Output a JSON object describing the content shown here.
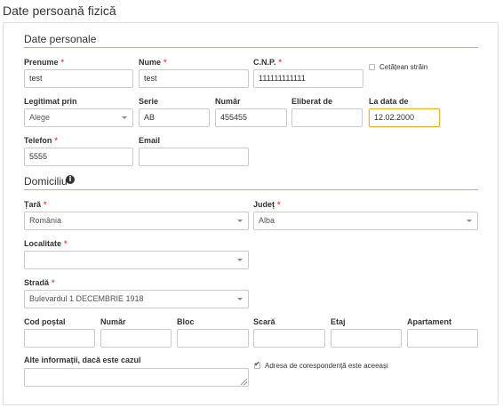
{
  "page": {
    "title": "Date persoană fizică"
  },
  "sections": {
    "personal": "Date personale",
    "domicile": "Domiciliu"
  },
  "colors": {
    "accent": "#f0a92e",
    "required": "#d9534f",
    "focus": "#f0b429"
  },
  "personal": {
    "first_name": {
      "label": "Prenume",
      "value": "test"
    },
    "last_name": {
      "label": "Nume",
      "value": "test"
    },
    "cnp": {
      "label": "C.N.P.",
      "value": "111111111111"
    },
    "foreign_citizen": {
      "label": "Cetățean străin",
      "checked": false
    },
    "id_type": {
      "label": "Legitimat prin",
      "value": "Alege"
    },
    "series": {
      "label": "Serie",
      "value": "AB"
    },
    "number": {
      "label": "Număr",
      "value": "455455"
    },
    "issued_by": {
      "label": "Eliberat de",
      "value": ""
    },
    "issued_date": {
      "label": "La data de",
      "value": "12.02.2000"
    },
    "phone": {
      "label": "Telefon",
      "value": "5555"
    },
    "email": {
      "label": "Email",
      "value": ""
    }
  },
  "domicile": {
    "country": {
      "label": "Țară",
      "value": "România"
    },
    "county": {
      "label": "Județ",
      "value": "Alba"
    },
    "locality": {
      "label": "Localitate",
      "value": ""
    },
    "street": {
      "label": "Stradă",
      "value": "Bulevardul 1 DECEMBRIE 1918"
    },
    "postal_code": {
      "label": "Cod poștal",
      "value": ""
    },
    "number": {
      "label": "Număr",
      "value": ""
    },
    "block": {
      "label": "Bloc",
      "value": ""
    },
    "stair": {
      "label": "Scară",
      "value": ""
    },
    "floor": {
      "label": "Etaj",
      "value": ""
    },
    "apartment": {
      "label": "Apartament",
      "value": ""
    },
    "other_info": {
      "label": "Alte informații, dacă este cazul",
      "value": ""
    },
    "same_address": {
      "label": "Adresa de corespondență este aceeași",
      "checked": true
    }
  },
  "required_mark": "*"
}
